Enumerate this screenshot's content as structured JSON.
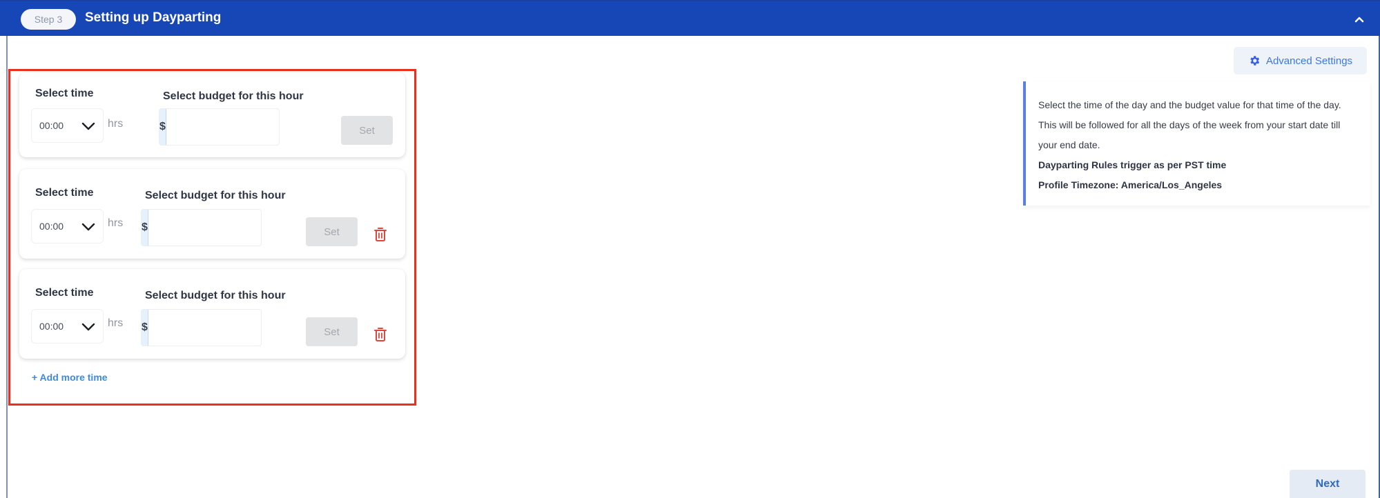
{
  "header": {
    "step_label": "Step 3",
    "title": "Setting up Dayparting",
    "collapse_icon": "chevron-up-icon",
    "background_color": "#1746b6"
  },
  "time_slots": [
    {
      "time_label": "Select time",
      "time_value": "00:00",
      "time_unit": "hrs",
      "budget_label": "Select budget for this hour",
      "currency_symbol": "$",
      "budget_value": "",
      "set_label": "Set",
      "deletable": false
    },
    {
      "time_label": "Select time",
      "time_value": "00:00",
      "time_unit": "hrs",
      "budget_label": "Select budget for this hour",
      "currency_symbol": "$",
      "budget_value": "",
      "set_label": "Set",
      "deletable": true
    },
    {
      "time_label": "Select time",
      "time_value": "00:00",
      "time_unit": "hrs",
      "budget_label": "Select budget for this hour",
      "currency_symbol": "$",
      "budget_value": "",
      "set_label": "Set",
      "deletable": true
    }
  ],
  "add_more_label": "+ Add more time",
  "advanced_settings": {
    "label": "Advanced Settings",
    "icon": "gear-icon"
  },
  "info": {
    "description": "Select the time of the day and the budget value for that time of the day. This will be followed for all the days of the week from your start date till your end date.",
    "trigger_note": "Dayparting Rules trigger as per PST time",
    "timezone_note": "Profile Timezone: America/Los_Angeles"
  },
  "footer": {
    "next_label": "Next"
  },
  "colors": {
    "highlight_border": "#e8301c",
    "accent_blue": "#3b78e7",
    "delete_red": "#e0443a"
  }
}
